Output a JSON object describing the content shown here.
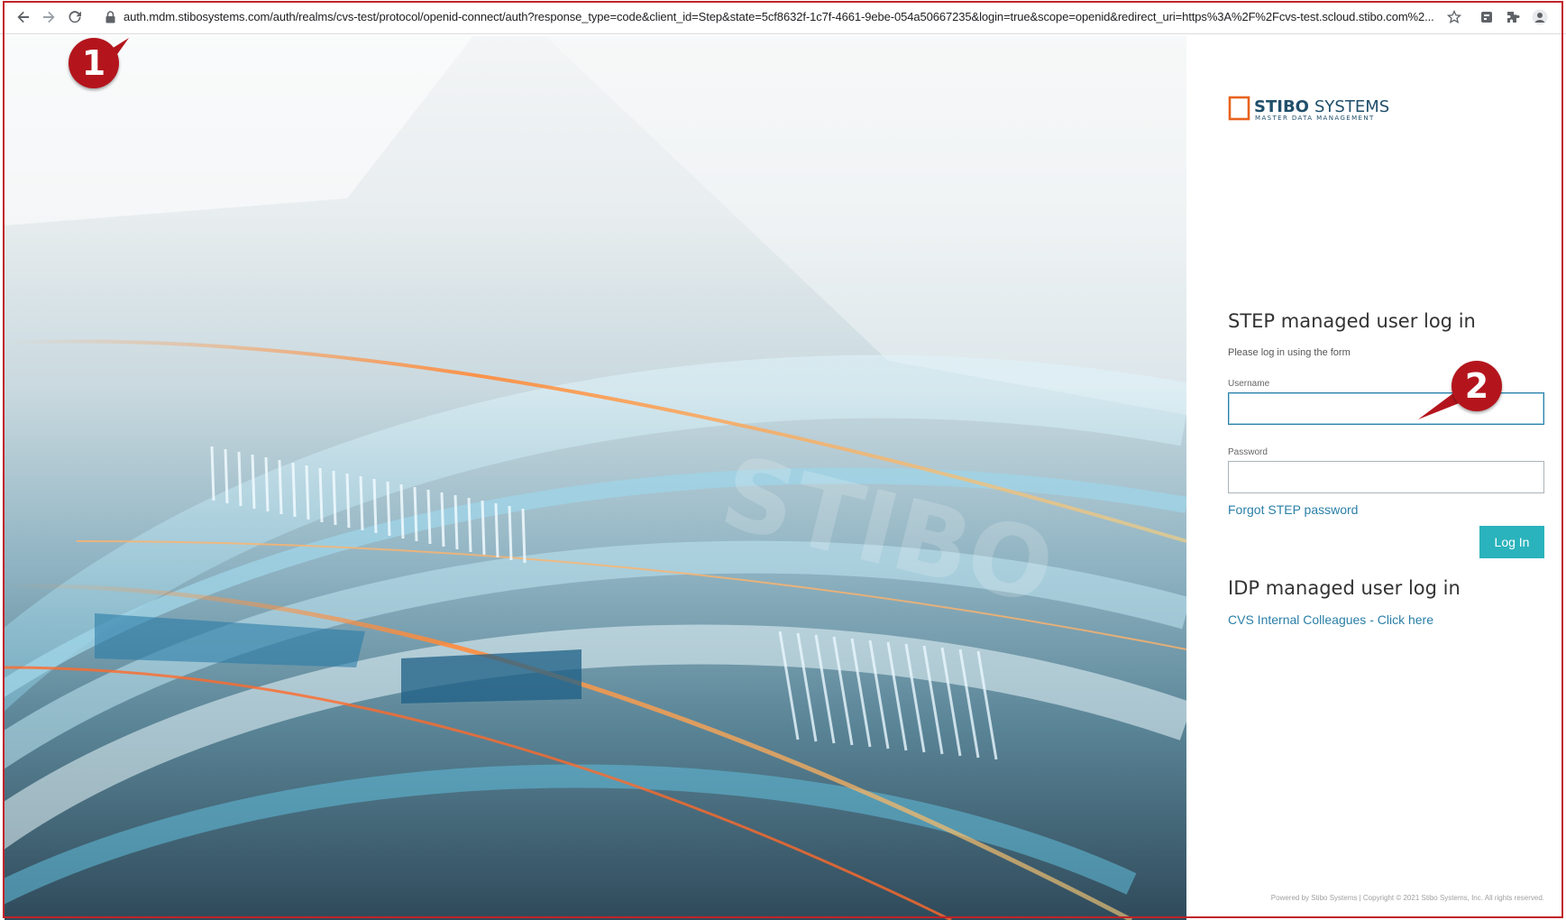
{
  "browser": {
    "url": "auth.mdm.stibosystems.com/auth/realms/cvs-test/protocol/openid-connect/auth?response_type=code&client_id=Step&state=5cf8632f-1c7f-4661-9ebe-054a50667235&login=true&scope=openid&redirect_uri=https%3A%2F%2Fcvs-test.scloud.stibo.com%2...",
    "icons": [
      "back-arrow-icon",
      "forward-arrow-icon",
      "reload-icon",
      "lock-icon",
      "star-icon",
      "extension-icon",
      "puzzle-icon",
      "profile-icon"
    ]
  },
  "brand": {
    "logo_primary": "STIBO",
    "logo_secondary": "SYSTEMS",
    "logo_tagline": "MASTER DATA MANAGEMENT",
    "accent": "#2ab3bc",
    "link_color": "#2a7fa7",
    "logo_square_color": "#e8631d",
    "logo_text_color": "#1f4f6b"
  },
  "step_login": {
    "title": "STEP managed user log in",
    "subtitle": "Please log in using the form",
    "username_label": "Username",
    "username_value": "",
    "password_label": "Password",
    "password_value": "",
    "forgot_link": "Forgot STEP password",
    "submit_label": "Log In"
  },
  "idp_login": {
    "title": "IDP managed user log in",
    "link": "CVS Internal Colleagues - Click here"
  },
  "footer": {
    "text": "Powered by Stibo Systems | Copyright © 2021 Stibo Systems, Inc. All rights reserved."
  },
  "annotations": {
    "marker_1": "1",
    "marker_2": "2",
    "marker_color": "#b4151d"
  }
}
